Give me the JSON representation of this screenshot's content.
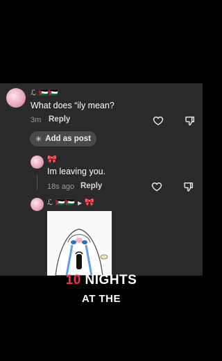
{
  "comment": {
    "username": "ℒ",
    "text": "What does “ily mean?",
    "time": "3m",
    "reply_label": "Reply",
    "add_as_post_label": "Add as post"
  },
  "reply1": {
    "username_emoji": "🎀",
    "text": "Im leaving you.",
    "time": "18s ago",
    "reply_label": "Reply"
  },
  "reply2": {
    "username": "ℒ",
    "mention_emoji": "🎀"
  },
  "caption": {
    "highlight": "10",
    "line1_rest": " NIGHTS",
    "line2": "AT THE"
  },
  "colors": {
    "panel": "#2a2a2a",
    "background": "#000000",
    "caption_highlight": "#ff2b4e"
  },
  "icons": [
    "heart-icon",
    "dislike-icon",
    "sparkle-icon",
    "bow-emoji"
  ]
}
